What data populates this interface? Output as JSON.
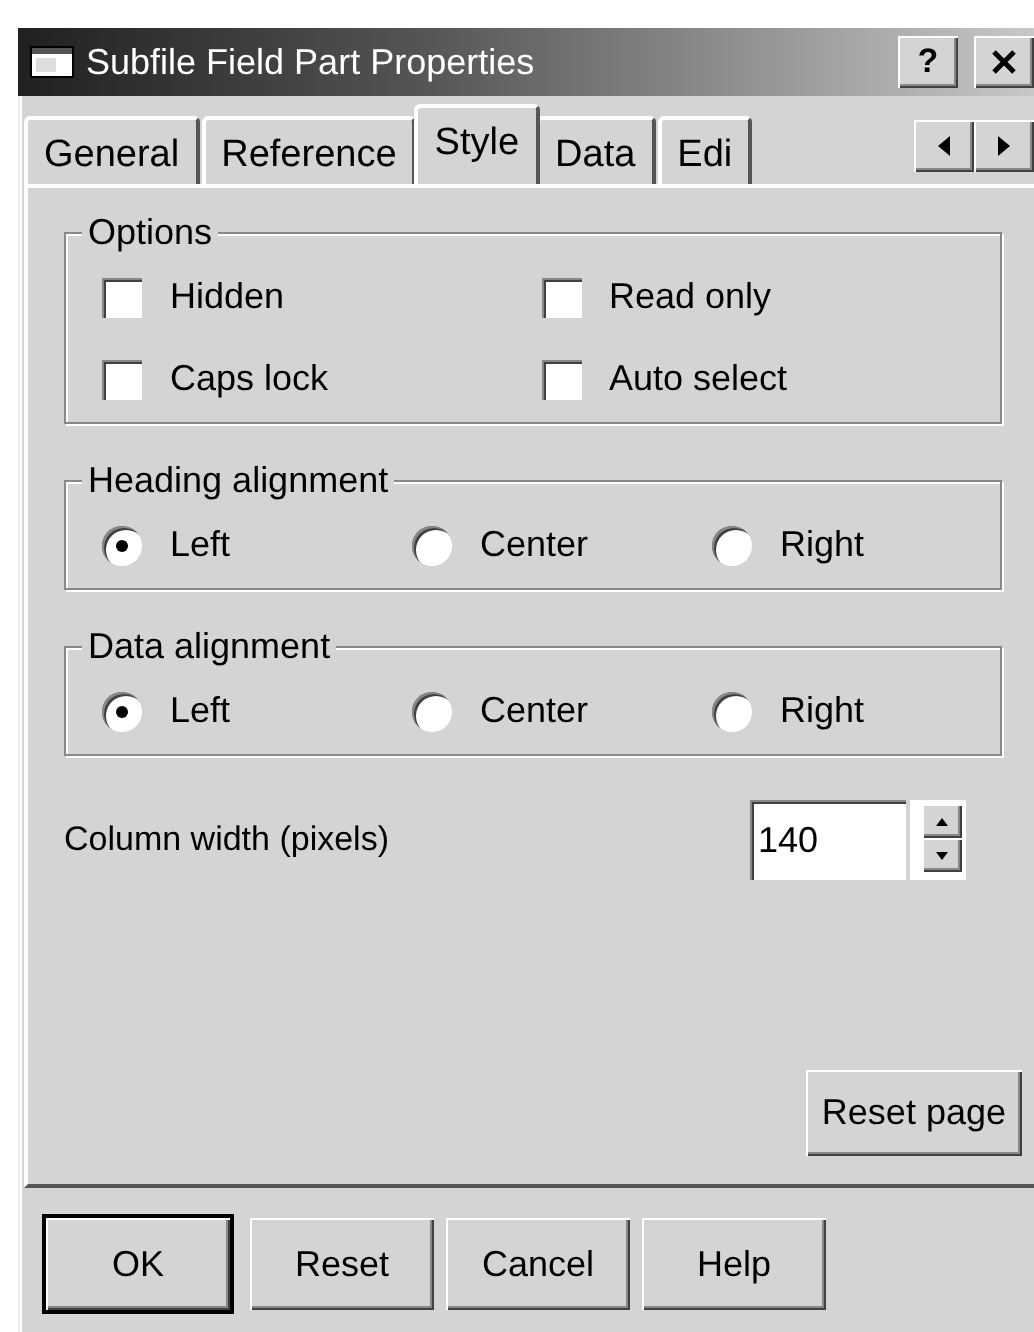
{
  "window": {
    "title": "Subfile Field Part Properties",
    "help_button": "?"
  },
  "tabs": [
    {
      "label": "General",
      "selected": false
    },
    {
      "label": "Reference",
      "selected": false
    },
    {
      "label": "Style",
      "selected": true
    },
    {
      "label": "Data",
      "selected": false
    },
    {
      "label": "Edi",
      "selected": false
    }
  ],
  "options": {
    "title": "Options",
    "items": [
      {
        "label": "Hidden",
        "checked": false
      },
      {
        "label": "Read only",
        "checked": false
      },
      {
        "label": "Caps lock",
        "checked": false
      },
      {
        "label": "Auto select",
        "checked": false
      }
    ]
  },
  "heading_alignment": {
    "title": "Heading alignment",
    "choices": [
      {
        "label": "Left",
        "selected": true
      },
      {
        "label": "Center",
        "selected": false
      },
      {
        "label": "Right",
        "selected": false
      }
    ]
  },
  "data_alignment": {
    "title": "Data alignment",
    "choices": [
      {
        "label": "Left",
        "selected": true
      },
      {
        "label": "Center",
        "selected": false
      },
      {
        "label": "Right",
        "selected": false
      }
    ]
  },
  "column_width": {
    "label": "Column width (pixels)",
    "value": "140"
  },
  "reset_page_button": "Reset page",
  "buttons": [
    {
      "label": "OK",
      "default": true
    },
    {
      "label": "Reset",
      "default": false
    },
    {
      "label": "Cancel",
      "default": false
    },
    {
      "label": "Help",
      "default": false
    }
  ]
}
